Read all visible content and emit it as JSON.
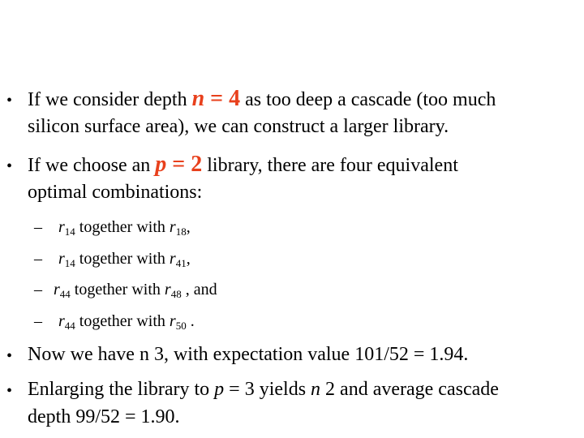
{
  "accent_color": "#e8401c",
  "bullets": [
    {
      "line1": {
        "pre": "If we consider depth ",
        "var": "n",
        "eq": " = 4",
        "post": " as too deep a cascade (too much"
      },
      "line2": "silicon surface area), we can construct a larger library."
    },
    {
      "line1": {
        "pre": "If we choose an ",
        "var": "p",
        "eq": " = 2",
        "post": " library, there are four equivalent"
      },
      "line2": "optimal combinations:"
    }
  ],
  "sub_items": [
    {
      "a": "r",
      "a_sub": "14",
      "mid": " together with ",
      "b": "r",
      "b_sub": "18",
      "end": ","
    },
    {
      "a": "r",
      "a_sub": "14",
      "mid": " together with ",
      "b": "r",
      "b_sub": "41",
      "end": ","
    },
    {
      "a": "r",
      "a_sub": "44",
      "mid": " together with ",
      "b": "r",
      "b_sub": "48",
      "end": " , and"
    },
    {
      "a": "r",
      "a_sub": "44",
      "mid": " together with ",
      "b": "r",
      "b_sub": "50",
      "end": " ."
    }
  ],
  "bullet3": "Now we have n 3, with expectation value 101/52 = 1.94.",
  "bullet4": {
    "p1": "Enlarging the library to ",
    "v1": "p",
    "p2": " = 3 yields ",
    "v2": "n",
    "p3": " 2 and average cascade",
    "line2": "depth 99/52 = 1.90."
  },
  "bullet_char": "•",
  "dash_char": "–"
}
